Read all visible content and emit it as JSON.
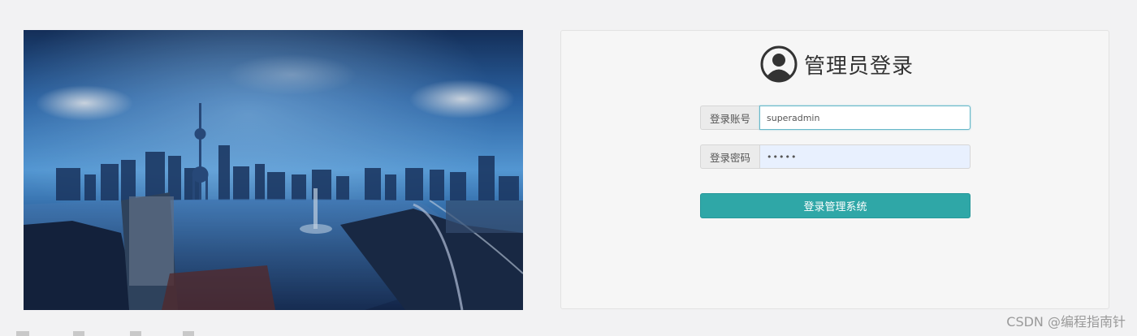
{
  "login": {
    "title": "管理员登录",
    "account_label": "登录账号",
    "account_value": "superadmin",
    "password_label": "登录密码",
    "password_value": "•••••",
    "submit_label": "登录管理系统"
  },
  "icons": {
    "user": "user-circle-icon"
  },
  "colors": {
    "page_bg": "#f2f2f3",
    "panel_bg": "#f6f6f6",
    "button": "#2fa7a7",
    "focus_border": "#66b7c8",
    "autofill_bg": "#e8f0fe"
  },
  "watermark": "CSDN @编程指南针"
}
